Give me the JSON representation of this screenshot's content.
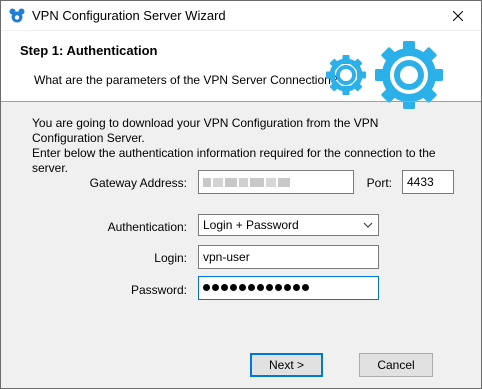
{
  "window": {
    "title": "VPN Configuration Server Wizard",
    "close_icon": "close-icon",
    "app_icon": "mouse-shield-icon"
  },
  "header": {
    "step_title": "Step 1: Authentication",
    "subtitle": "What are the parameters of the VPN Server Connection?",
    "accent_color": "#2cb0ea"
  },
  "intro": {
    "line1": "You are going to download your VPN Configuration from the VPN Configuration Server.",
    "line2": "Enter below the authentication information required for the connection to the server."
  },
  "form": {
    "gateway_label": "Gateway Address:",
    "port_label": "Port:",
    "port_value": "4433",
    "auth_label": "Authentication:",
    "auth_value": "Login + Password",
    "login_label": "Login:",
    "login_value": "vpn-user",
    "password_label": "Password:",
    "password_length": 12
  },
  "buttons": {
    "next": "Next >",
    "cancel": "Cancel"
  }
}
